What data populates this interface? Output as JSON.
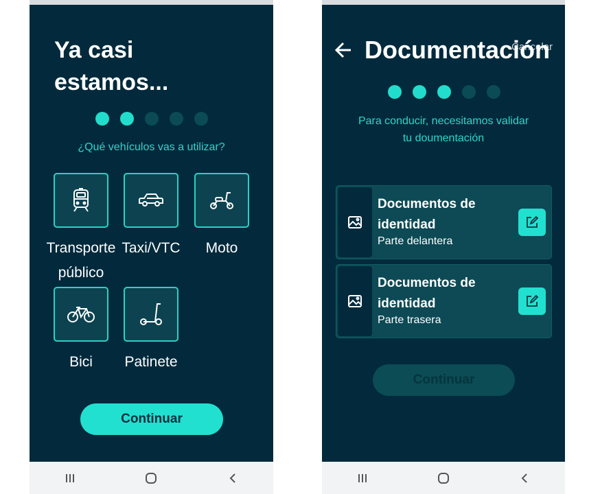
{
  "screen1": {
    "title_line1": "Ya casi",
    "title_line2": "estamos...",
    "progress": {
      "total": 5,
      "active": 2
    },
    "question": "¿Qué vehículos vas a utilizar?",
    "vehicles": [
      {
        "label": "Transporte público",
        "icon": "train-icon"
      },
      {
        "label": "Taxi/VTC",
        "icon": "car-icon"
      },
      {
        "label": "Moto",
        "icon": "scooter-moto-icon"
      },
      {
        "label": "Bici",
        "icon": "bicycle-icon"
      },
      {
        "label": "Patinete",
        "icon": "kick-scooter-icon"
      }
    ],
    "continue_label": "Continuar"
  },
  "screen2": {
    "title": "Documentación",
    "title_overlap": "Cancelar",
    "progress": {
      "total": 5,
      "active": 3
    },
    "info_line1": "Para conducir, necesitamos validar",
    "info_line2": "tu doumentación",
    "documents": [
      {
        "title": "Documentos de identidad",
        "subtitle": "Parte delantera"
      },
      {
        "title": "Documentos de identidad",
        "subtitle": "Parte trasera"
      }
    ],
    "continue_label": "Continuar",
    "continue_enabled": false
  },
  "colors": {
    "background": "#022a3c",
    "accent": "#22e0cf",
    "tile": "#0d4350",
    "card": "#0d4a55",
    "nav_bar": "#f1f3f4"
  }
}
